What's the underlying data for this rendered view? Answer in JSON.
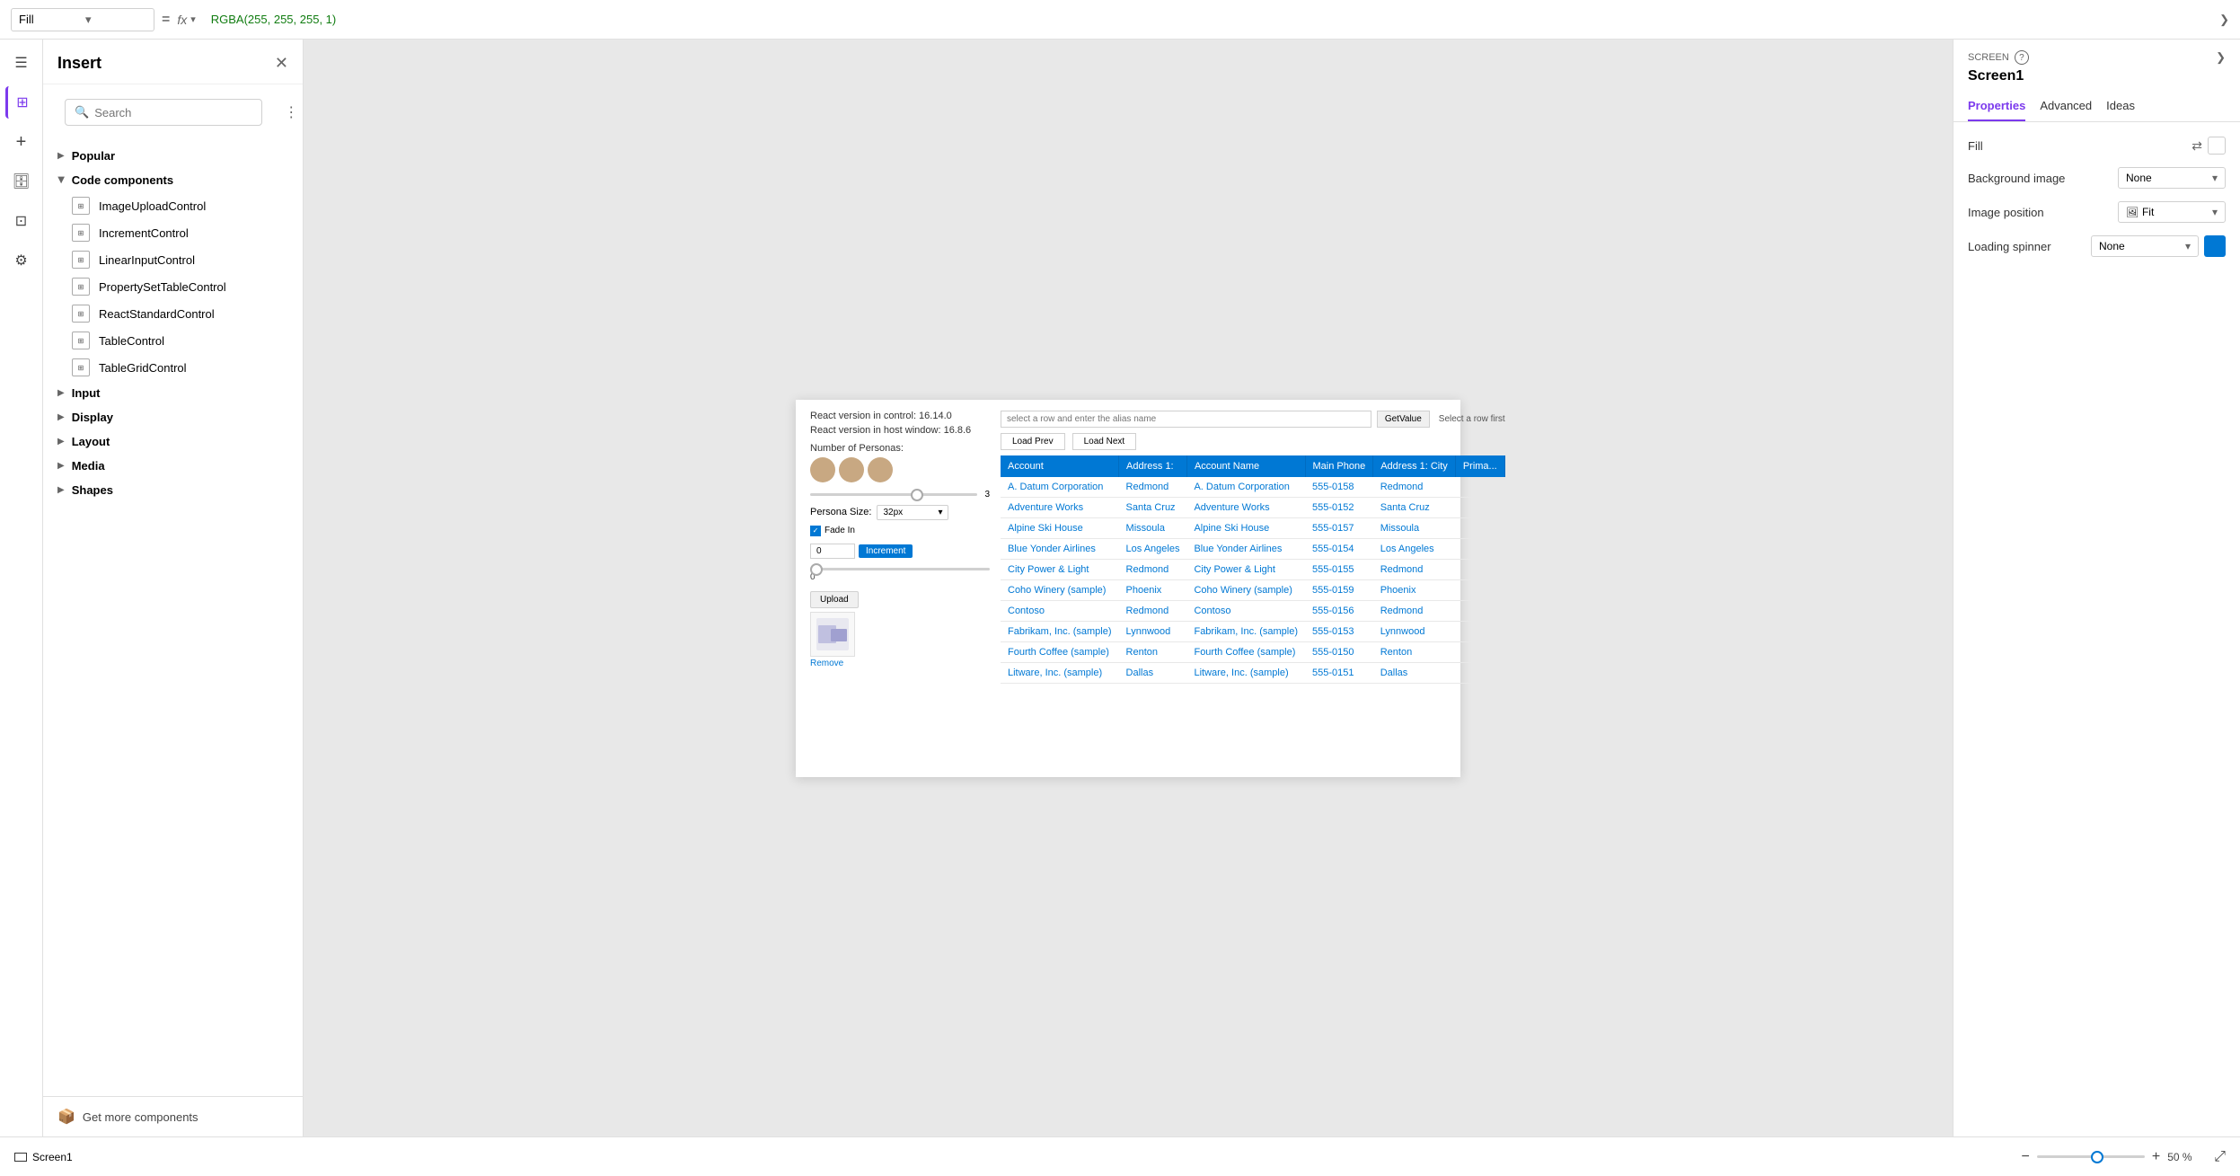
{
  "topbar": {
    "fill_label": "Fill",
    "fill_value": "RGBA(255, 255, 255, 1)",
    "equals_symbol": "=",
    "fx_label": "fx"
  },
  "insert_panel": {
    "title": "Insert",
    "search_placeholder": "Search",
    "sections": [
      {
        "id": "popular",
        "label": "Popular",
        "expanded": false
      },
      {
        "id": "code_components",
        "label": "Code components",
        "expanded": true,
        "items": [
          "ImageUploadControl",
          "IncrementControl",
          "LinearInputControl",
          "PropertySetTableControl",
          "ReactStandardControl",
          "TableControl",
          "TableGridControl"
        ]
      },
      {
        "id": "input",
        "label": "Input",
        "expanded": false
      },
      {
        "id": "display",
        "label": "Display",
        "expanded": false
      },
      {
        "id": "layout",
        "label": "Layout",
        "expanded": false
      },
      {
        "id": "media",
        "label": "Media",
        "expanded": false
      },
      {
        "id": "shapes",
        "label": "Shapes",
        "expanded": false
      }
    ],
    "get_more": "Get more components"
  },
  "canvas": {
    "preview": {
      "react_version_control": "React version in control: 16.14.0",
      "react_version_host": "React version in host window: 16.8.6",
      "persona_label": "Number of Personas:",
      "slider_value": "3",
      "persona_size_label": "Persona Size:",
      "persona_size_value": "32px",
      "fade_in_label": "Fade In",
      "increment_default": "0",
      "increment_btn": "Increment",
      "alias_placeholder": "select a row and enter the alias name",
      "get_value_btn": "GetValue",
      "select_hint": "Select a row first",
      "load_prev_btn": "Load Prev",
      "load_next_btn": "Load Next",
      "upload_btn": "Upload",
      "remove_btn": "Remove",
      "table_headers": [
        "Account",
        "Address 1:",
        "Account Name",
        "Main Phone",
        "Address 1: City",
        "Prima..."
      ],
      "table_rows": [
        [
          "A. Datum Corporation",
          "Redmond",
          "A. Datum Corporation",
          "555-0158",
          "Redmond",
          ""
        ],
        [
          "Adventure Works",
          "Santa Cruz",
          "Adventure Works",
          "555-0152",
          "Santa Cruz",
          ""
        ],
        [
          "Alpine Ski House",
          "Missoula",
          "Alpine Ski House",
          "555-0157",
          "Missoula",
          ""
        ],
        [
          "Blue Yonder Airlines",
          "Los Angeles",
          "Blue Yonder Airlines",
          "555-0154",
          "Los Angeles",
          ""
        ],
        [
          "City Power & Light",
          "Redmond",
          "City Power & Light",
          "555-0155",
          "Redmond",
          ""
        ],
        [
          "Coho Winery (sample)",
          "Phoenix",
          "Coho Winery (sample)",
          "555-0159",
          "Phoenix",
          ""
        ],
        [
          "Contoso",
          "Redmond",
          "Contoso",
          "555-0156",
          "Redmond",
          ""
        ],
        [
          "Fabrikam, Inc. (sample)",
          "Lynnwood",
          "Fabrikam, Inc. (sample)",
          "555-0153",
          "Lynnwood",
          ""
        ],
        [
          "Fourth Coffee (sample)",
          "Renton",
          "Fourth Coffee (sample)",
          "555-0150",
          "Renton",
          ""
        ],
        [
          "Litware, Inc. (sample)",
          "Dallas",
          "Litware, Inc. (sample)",
          "555-0151",
          "Dallas",
          ""
        ]
      ]
    }
  },
  "bottom_bar": {
    "screen_name": "Screen1",
    "zoom_percent": "50 %",
    "zoom_minus": "−",
    "zoom_plus": "+"
  },
  "props_panel": {
    "screen_label": "SCREEN",
    "title": "Screen1",
    "tabs": [
      "Properties",
      "Advanced",
      "Ideas"
    ],
    "active_tab": "Properties",
    "fill_label": "Fill",
    "background_image_label": "Background image",
    "background_image_value": "None",
    "image_position_label": "Image position",
    "image_position_value": "Fit",
    "loading_spinner_label": "Loading spinner",
    "loading_spinner_value": "None"
  }
}
